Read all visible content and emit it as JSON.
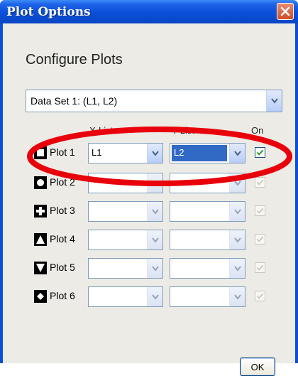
{
  "window": {
    "title": "Plot Options"
  },
  "heading": "Configure Plots",
  "dataset": {
    "selected": "Data Set 1: (L1, L2)"
  },
  "columns": {
    "x": "X-List",
    "y": "Y-List",
    "on": "On"
  },
  "plots": [
    {
      "label": "Plot 1",
      "marker": "square-marker-icon",
      "x": "L1",
      "y": "L2",
      "on": true,
      "enabled": true
    },
    {
      "label": "Plot 2",
      "marker": "circle-marker-icon",
      "x": "",
      "y": "",
      "on": true,
      "enabled": false
    },
    {
      "label": "Plot 3",
      "marker": "plus-marker-icon",
      "x": "",
      "y": "",
      "on": true,
      "enabled": false
    },
    {
      "label": "Plot 4",
      "marker": "triangle-up-marker-icon",
      "x": "",
      "y": "",
      "on": true,
      "enabled": false
    },
    {
      "label": "Plot 5",
      "marker": "triangle-down-marker-icon",
      "x": "",
      "y": "",
      "on": true,
      "enabled": false
    },
    {
      "label": "Plot 6",
      "marker": "diamond-marker-icon",
      "x": "",
      "y": "",
      "on": true,
      "enabled": false
    }
  ],
  "buttons": {
    "ok": "OK"
  },
  "colors": {
    "titlebar": "#0a4fd8",
    "highlight_oval": "#e8000b",
    "selection": "#316ac5",
    "checkmark": "#21a121"
  }
}
